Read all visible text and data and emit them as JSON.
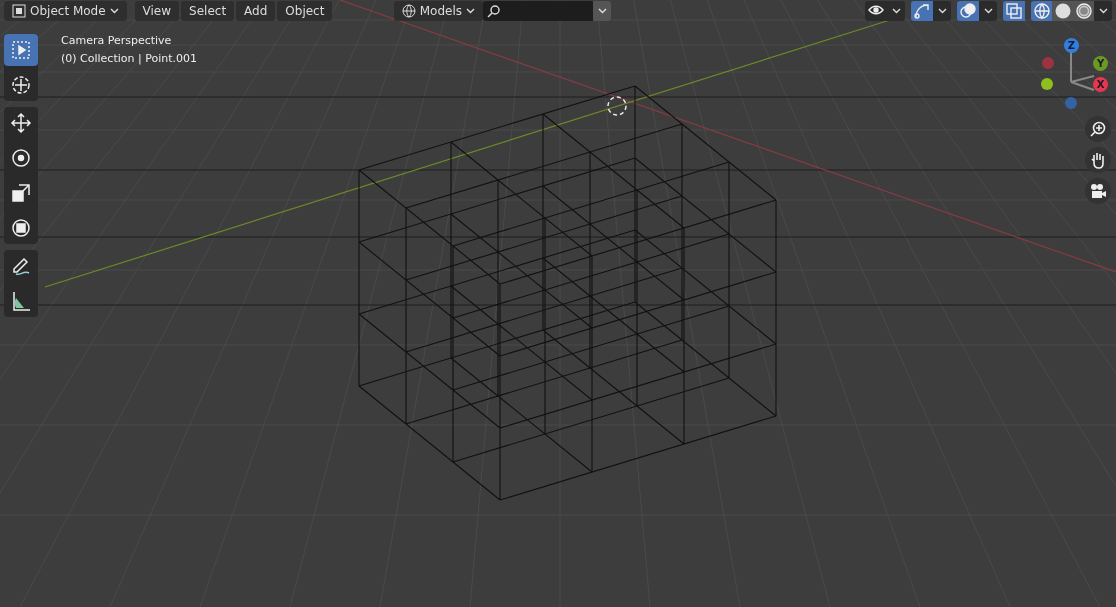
{
  "header": {
    "mode": {
      "label": "Object Mode"
    },
    "menus": [
      "View",
      "Select",
      "Add",
      "Object"
    ],
    "collection_filter": {
      "label": "Models"
    },
    "toggles": [
      {
        "kind": "visibility",
        "on": false
      },
      {
        "kind": "gizmo",
        "on": true
      },
      {
        "kind": "overlay",
        "on": true
      },
      {
        "kind": "xray",
        "on": true
      }
    ],
    "shading": [
      {
        "kind": "wireframe",
        "selected": true
      },
      {
        "kind": "solid",
        "selected": false
      },
      {
        "kind": "material",
        "selected": false
      }
    ]
  },
  "viewport": {
    "view_name": "Camera Perspective",
    "object_info": "(0) Collection | Point.001"
  },
  "toolbar": {
    "groups": [
      [
        {
          "kind": "select",
          "selected": true
        },
        {
          "kind": "cursor",
          "selected": false
        }
      ],
      [
        {
          "kind": "move",
          "selected": false
        },
        {
          "kind": "rotate",
          "selected": false
        },
        {
          "kind": "scale",
          "selected": false
        },
        {
          "kind": "transform",
          "selected": false
        }
      ],
      [
        {
          "kind": "annotate",
          "selected": false
        },
        {
          "kind": "measure",
          "selected": false
        }
      ]
    ]
  },
  "gizmo": {
    "axes": [
      {
        "label": "Z",
        "color": "#2f7fe0"
      },
      {
        "label": "Y",
        "color": "#6a9a23"
      },
      {
        "label": "X",
        "color": "#e8364f"
      }
    ]
  },
  "navigation": [
    {
      "kind": "zoom"
    },
    {
      "kind": "pan"
    },
    {
      "kind": "camera"
    }
  ]
}
